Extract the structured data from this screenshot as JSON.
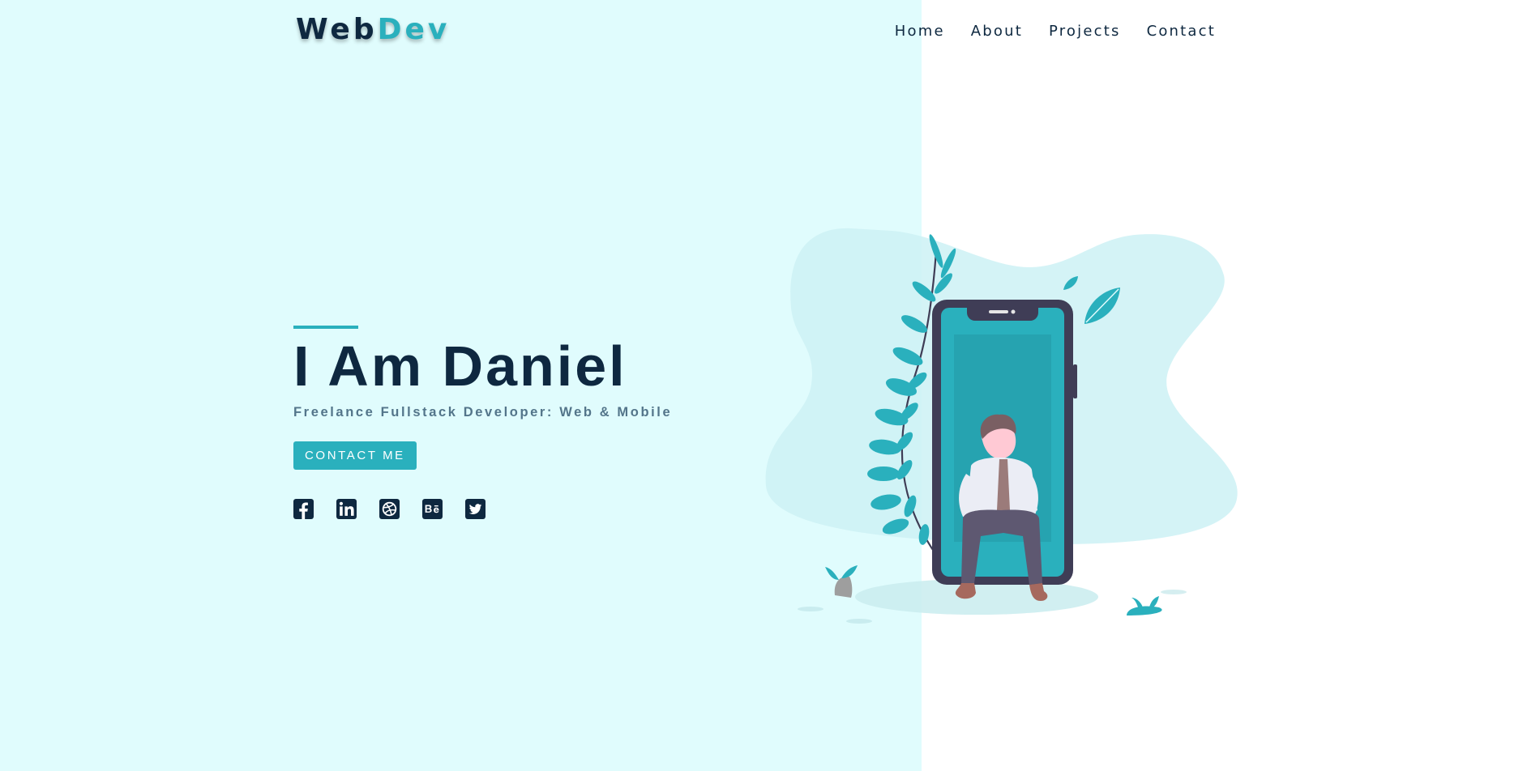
{
  "brand": {
    "part1": "Web",
    "part2": "Dev"
  },
  "nav": {
    "items": [
      "Home",
      "About",
      "Projects",
      "Contact"
    ]
  },
  "hero": {
    "title": "I Am Daniel",
    "subtitle": "Freelance Fullstack Developer: Web & Mobile",
    "cta": "CONTACT ME"
  },
  "socials": [
    "facebook-icon",
    "linkedin-icon",
    "dribbble-icon",
    "behance-icon",
    "twitter-icon"
  ],
  "colors": {
    "accent": "#2ab0bd",
    "dark": "#0e2840",
    "left_background": "#e0fcfd",
    "subtitle": "#53758a",
    "phone_frame": "#3f3d56"
  }
}
